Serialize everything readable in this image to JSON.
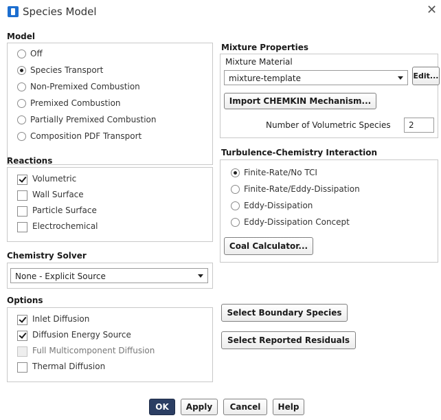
{
  "window": {
    "title": "Species Model",
    "close_glyph": "✕"
  },
  "model": {
    "title": "Model",
    "options": [
      {
        "label": "Off",
        "checked": false
      },
      {
        "label": "Species Transport",
        "checked": true
      },
      {
        "label": "Non-Premixed Combustion",
        "checked": false
      },
      {
        "label": "Premixed Combustion",
        "checked": false
      },
      {
        "label": "Partially Premixed Combustion",
        "checked": false
      },
      {
        "label": "Composition PDF Transport",
        "checked": false
      }
    ]
  },
  "reactions": {
    "title": "Reactions",
    "options": [
      {
        "label": "Volumetric",
        "checked": true
      },
      {
        "label": "Wall Surface",
        "checked": false
      },
      {
        "label": "Particle Surface",
        "checked": false
      },
      {
        "label": "Electrochemical",
        "checked": false
      }
    ]
  },
  "chemistry_solver": {
    "title": "Chemistry Solver",
    "value": "None - Explicit Source"
  },
  "options": {
    "title": "Options",
    "items": [
      {
        "label": "Inlet Diffusion",
        "checked": true,
        "disabled": false
      },
      {
        "label": "Diffusion Energy Source",
        "checked": true,
        "disabled": false
      },
      {
        "label": "Full Multicomponent Diffusion",
        "checked": false,
        "disabled": true
      },
      {
        "label": "Thermal Diffusion",
        "checked": false,
        "disabled": false
      }
    ]
  },
  "mixture_properties": {
    "title": "Mixture Properties",
    "material_label": "Mixture Material",
    "material_value": "mixture-template",
    "edit_button": "Edit...",
    "import_button": "Import CHEMKIN Mechanism...",
    "num_species_label": "Number of Volumetric Species",
    "num_species_value": "2"
  },
  "turbulence_chemistry": {
    "title": "Turbulence-Chemistry Interaction",
    "options": [
      {
        "label": "Finite-Rate/No TCI",
        "checked": true
      },
      {
        "label": "Finite-Rate/Eddy-Dissipation",
        "checked": false
      },
      {
        "label": "Eddy-Dissipation",
        "checked": false
      },
      {
        "label": "Eddy-Dissipation Concept",
        "checked": false
      }
    ],
    "coal_button": "Coal Calculator..."
  },
  "side_buttons": {
    "select_boundary": "Select Boundary Species",
    "select_residuals": "Select Reported Residuals"
  },
  "footer": {
    "ok": "OK",
    "apply": "Apply",
    "cancel": "Cancel",
    "help": "Help"
  },
  "colors": {
    "primary_button": "#2b3e63",
    "app_icon": "#1c6ecf",
    "group_border": "#c8c8c8"
  }
}
